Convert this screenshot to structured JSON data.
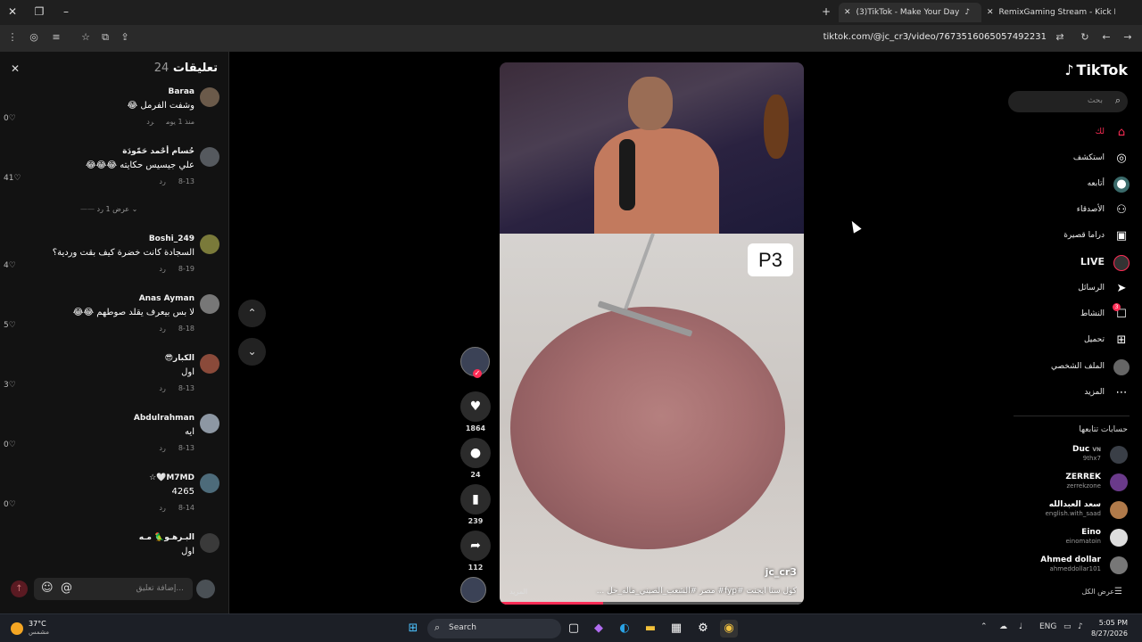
{
  "browser": {
    "tabs": [
      {
        "title": "(3)TikTok - Make Your Day",
        "active": true
      },
      {
        "title": "RemixGaming Stream - Kick De",
        "active": false
      }
    ],
    "url": "tiktok.com/@jc_cr3/video/7673516065057492231"
  },
  "comments": {
    "title": "تعليقات",
    "count": "24",
    "items": [
      {
        "user": "Baraa",
        "text": "وشفت الفرمل 😂",
        "date": "منذ 1 يوم",
        "reply": "رد",
        "likes": "0"
      },
      {
        "user": "حُسام أحْمد حَمّودَة",
        "text": "علي جيسيس حكايته 😂😂😂",
        "date": "8-13",
        "reply": "رد",
        "likes": "41"
      },
      {
        "user": "Boshi_249",
        "text": "السجادة كانت خضرة كيف بقت وردية؟",
        "date": "8-19",
        "reply": "رد",
        "likes": "4"
      },
      {
        "user": "Anas Ayman",
        "text": "لا بس بيعرف يقلد صوطهم 😂😂",
        "date": "8-18",
        "reply": "رد",
        "likes": "5"
      },
      {
        "user": "الكبار😎",
        "text": "اول",
        "date": "8-13",
        "reply": "رد",
        "likes": "3"
      },
      {
        "user": "Abdulrahman",
        "text": "ايه",
        "date": "8-13",
        "reply": "رد",
        "likes": "0"
      },
      {
        "user": "M7MD🤍☆",
        "text": "4265",
        "date": "8-14",
        "reply": "رد",
        "likes": "0"
      },
      {
        "user": "البـرهـو🦜 مـه",
        "text": "اول",
        "date": "",
        "reply": "",
        "likes": ""
      }
    ],
    "show_replies": "عرض 1 رد",
    "input_placeholder": "إضافة تعليق...",
    "at_symbol": "@"
  },
  "video": {
    "overlay_label": "P3",
    "author": "jc_cr3",
    "description": "كول سنا ايجنت #fyp# مصر #الشعب_الصيني_ماله_حل ...",
    "more": "المزيد",
    "progress": 0.34
  },
  "actions": {
    "likes": "1864",
    "comments": "24",
    "saves": "239",
    "shares": "112"
  },
  "sidebar": {
    "logo": "TikTok",
    "search_placeholder": "بحث",
    "nav": [
      {
        "label": "لك",
        "icon": "home-icon",
        "active": true
      },
      {
        "label": "استكشف",
        "icon": "compass-icon"
      },
      {
        "label": "أتابعه",
        "icon": "following-icon"
      },
      {
        "label": "الأصدقاء",
        "icon": "friends-icon"
      },
      {
        "label": "دراما قصيرة",
        "icon": "drama-icon"
      },
      {
        "label": "LIVE",
        "icon": "live-icon"
      },
      {
        "label": "الرسائل",
        "icon": "send-icon"
      },
      {
        "label": "النشاط",
        "icon": "activity-icon",
        "badge": "3"
      },
      {
        "label": "تحميل",
        "icon": "upload-icon"
      },
      {
        "label": "الملف الشخصي",
        "icon": "profile-icon"
      },
      {
        "label": "المزيد",
        "icon": "more-icon"
      }
    ],
    "following_title": "حسابات تتابعها",
    "following": [
      {
        "name": "Duc",
        "suffix": "VN",
        "handle": "9thx7"
      },
      {
        "name": "ZERREK",
        "handle": "zerrekzone"
      },
      {
        "name": "سعد العبدالله",
        "handle": "english.with_saad"
      },
      {
        "name": "Eino",
        "handle": "einomatoin"
      },
      {
        "name": "Ahmed dollar",
        "handle": "ahmeddollar101"
      }
    ],
    "see_all": "عرض الكل"
  },
  "taskbar": {
    "temp": "37°C",
    "condition": "مشمس",
    "search_label": "Search",
    "lang": "ENG",
    "time": "5:05 PM",
    "date": "8/27/2026"
  },
  "colors": {
    "accent": "#fe2c55",
    "bg": "#000000",
    "panel": "#121212"
  }
}
